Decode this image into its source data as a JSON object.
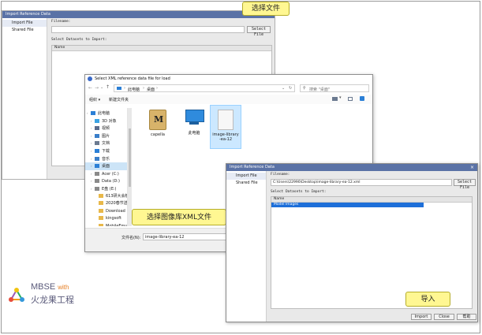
{
  "back_dialog": {
    "title": "Import Reference Data",
    "side_items": [
      "Import File",
      "Shared File"
    ],
    "filename_label": "Filename:",
    "select_file_button": "Select File",
    "datasets_label": "Select Datasets to Import:",
    "table_header": "Name"
  },
  "callouts": {
    "select_file": "选择文件",
    "select_xml": "选择图像库XML文件",
    "import": "导入"
  },
  "file_dialog": {
    "title": "Select XML reference data file for load",
    "breadcrumb": [
      "此电脑",
      "桌面"
    ],
    "search_placeholder": "搜索 \"桌面\"",
    "organize": "组织 ▾",
    "new_folder": "新建文件夹",
    "tree": [
      {
        "label": "此电脑",
        "indent": 0,
        "icon": "computer",
        "selected": false
      },
      {
        "label": "3D 对象",
        "indent": 1,
        "icon": "folder3d",
        "selected": false
      },
      {
        "label": "视频",
        "indent": 1,
        "icon": "video",
        "selected": false
      },
      {
        "label": "图片",
        "indent": 1,
        "icon": "picture",
        "selected": false
      },
      {
        "label": "文档",
        "indent": 1,
        "icon": "document",
        "selected": false
      },
      {
        "label": "下载",
        "indent": 1,
        "icon": "download",
        "selected": false
      },
      {
        "label": "音乐",
        "indent": 1,
        "icon": "music",
        "selected": false
      },
      {
        "label": "桌面",
        "indent": 1,
        "icon": "desktop",
        "selected": true
      },
      {
        "label": "Acer (C:)",
        "indent": 1,
        "icon": "drive",
        "selected": false
      },
      {
        "label": "Data (D:)",
        "indent": 1,
        "icon": "drive",
        "selected": false
      },
      {
        "label": "E盘 (E:)",
        "indent": 1,
        "icon": "drive",
        "selected": false
      },
      {
        "label": "613研大会模",
        "indent": 2,
        "icon": "folder",
        "selected": false
      },
      {
        "label": "2020春节送礼",
        "indent": 2,
        "icon": "folder",
        "selected": false
      },
      {
        "label": "Download",
        "indent": 2,
        "icon": "folder",
        "selected": false
      },
      {
        "label": "kingsoft",
        "indent": 2,
        "icon": "folder",
        "selected": false
      },
      {
        "label": "MobileEmuM",
        "indent": 2,
        "icon": "folder",
        "selected": false
      },
      {
        "label": "下载",
        "indent": 2,
        "icon": "folder",
        "selected": false
      }
    ],
    "files": [
      {
        "name": "capella",
        "type": "archive"
      },
      {
        "name": "此电脑",
        "type": "computer"
      },
      {
        "name": "image-library-ea-12",
        "type": "file"
      }
    ],
    "filename_label": "文件名(N):",
    "filename_value": "image-library-ea-12"
  },
  "front_dialog": {
    "title": "Import Reference Data",
    "side_items": [
      "Import File",
      "Shared File"
    ],
    "filename_label": "Filename:",
    "filename_value": "C:\\Users\\22990\\Desktop\\image-library-ea-12.xml",
    "select_file_button": "Select File",
    "datasets_label": "Select Datasets to Import:",
    "table_header": "Name",
    "rows": [
      "Model Images"
    ],
    "import_button": "Import",
    "close_button": "Close",
    "help_button": "帮助"
  },
  "logo": {
    "line1_a": "MBSE ",
    "line1_b": "with",
    "line2": "火龙果工程",
    "accent_color": "#e67e22",
    "text_color": "#5a5a7a"
  }
}
